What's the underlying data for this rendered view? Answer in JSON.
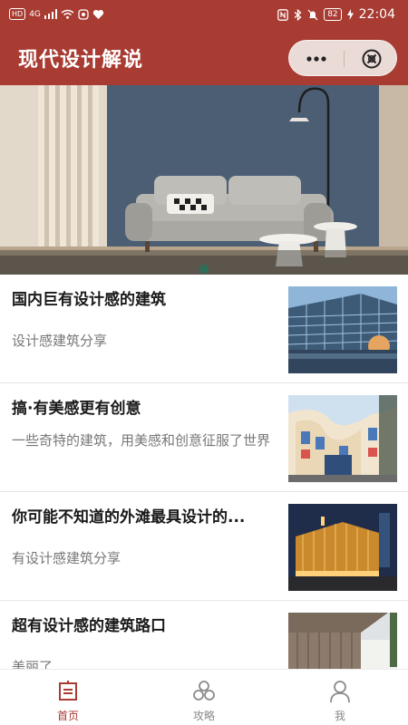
{
  "status_bar": {
    "left_badges": [
      "HD",
      "4G"
    ],
    "battery": "82",
    "time": "22:04"
  },
  "header": {
    "title": "现代设计解说",
    "more_glyph": "•••",
    "close_glyph": "⊗"
  },
  "banner": {
    "description_icon": "living-room-photo",
    "active_slide": 1
  },
  "articles": [
    {
      "title": "国内巨有设计感的建筑",
      "subtitle": "设计感建筑分享"
    },
    {
      "title": "搞·有美感更有创意",
      "subtitle": "一些奇特的建筑，用美感和创意征服了世界"
    },
    {
      "title": "你可能不知道的外滩最具设计的...",
      "subtitle": "有设计感建筑分享"
    },
    {
      "title": "超有设计感的建筑路口",
      "subtitle": "美丽了"
    }
  ],
  "tabbar": {
    "tabs": [
      {
        "label": "首页",
        "icon": "home-icon",
        "active": true
      },
      {
        "label": "攻略",
        "icon": "guide-icon",
        "active": false
      },
      {
        "label": "我",
        "icon": "profile-icon",
        "active": false
      }
    ]
  },
  "colors": {
    "brand_red": "#a83b32",
    "capsule_bg": "#eadbd6",
    "active_tab": "#a83b32",
    "inactive_tab": "#8a8a8a"
  }
}
